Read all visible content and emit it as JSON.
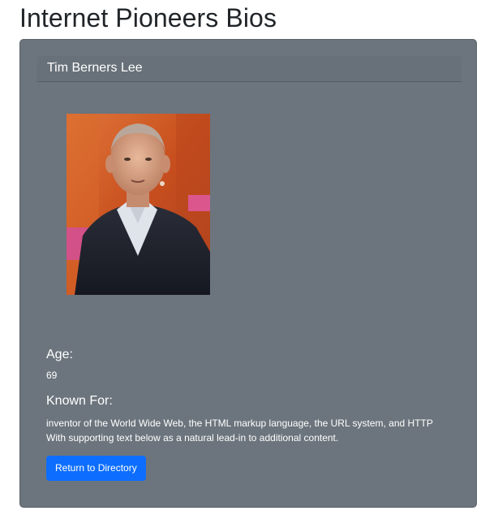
{
  "page": {
    "title": "Internet Pioneers Bios"
  },
  "bio": {
    "name": "Tim Berners Lee",
    "photo_alt": "Tim Berners Lee",
    "age_label": "Age:",
    "age_value": "69",
    "known_for_label": "Known For:",
    "known_for_line1": "inventor of the World Wide Web, the HTML markup language, the URL system, and HTTP",
    "known_for_line2": "With supporting text below as a natural lead-in to additional content."
  },
  "actions": {
    "return_label": "Return to Directory"
  },
  "colors": {
    "card_bg": "#6c757d",
    "primary": "#0d6efd",
    "title_text": "#212529"
  }
}
